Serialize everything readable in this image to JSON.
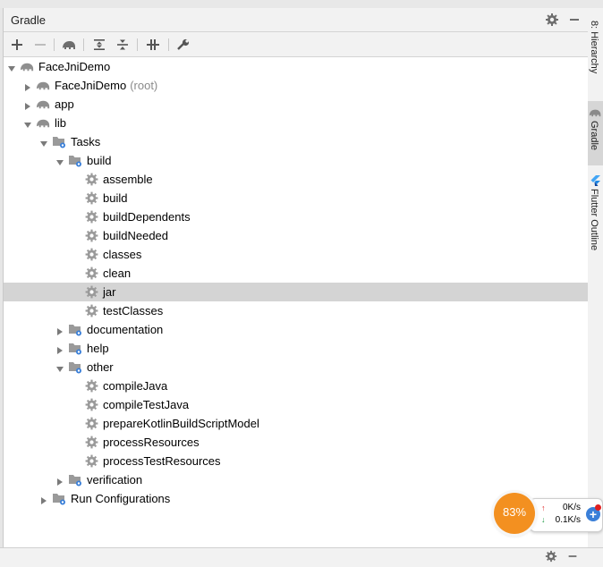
{
  "window": {
    "title": "Gradle"
  },
  "sidebar": {
    "tabs": [
      {
        "label": "8: Hierarchy",
        "active": false
      },
      {
        "label": "Gradle",
        "active": true
      },
      {
        "label": "Flutter Outline",
        "active": false
      }
    ]
  },
  "toolbar": {
    "icons": [
      "add-icon",
      "remove-icon",
      "elephant-icon",
      "expand-all-icon",
      "collapse-all-icon",
      "toggle-offline-icon",
      "wrench-icon"
    ]
  },
  "tree": [
    {
      "label": "FaceJniDemo",
      "suffix": "",
      "depth": 0,
      "arrow": "down",
      "icon": "elephant"
    },
    {
      "label": "FaceJniDemo",
      "suffix": "(root)",
      "depth": 1,
      "arrow": "right",
      "icon": "elephant"
    },
    {
      "label": "app",
      "suffix": "",
      "depth": 1,
      "arrow": "right",
      "icon": "elephant"
    },
    {
      "label": "lib",
      "suffix": "",
      "depth": 1,
      "arrow": "down",
      "icon": "elephant"
    },
    {
      "label": "Tasks",
      "suffix": "",
      "depth": 2,
      "arrow": "down",
      "icon": "folder"
    },
    {
      "label": "build",
      "suffix": "",
      "depth": 3,
      "arrow": "down",
      "icon": "folder"
    },
    {
      "label": "assemble",
      "suffix": "",
      "depth": 4,
      "arrow": "",
      "icon": "gear"
    },
    {
      "label": "build",
      "suffix": "",
      "depth": 4,
      "arrow": "",
      "icon": "gear"
    },
    {
      "label": "buildDependents",
      "suffix": "",
      "depth": 4,
      "arrow": "",
      "icon": "gear"
    },
    {
      "label": "buildNeeded",
      "suffix": "",
      "depth": 4,
      "arrow": "",
      "icon": "gear"
    },
    {
      "label": "classes",
      "suffix": "",
      "depth": 4,
      "arrow": "",
      "icon": "gear"
    },
    {
      "label": "clean",
      "suffix": "",
      "depth": 4,
      "arrow": "",
      "icon": "gear"
    },
    {
      "label": "jar",
      "suffix": "",
      "depth": 4,
      "arrow": "",
      "icon": "gear",
      "selected": true
    },
    {
      "label": "testClasses",
      "suffix": "",
      "depth": 4,
      "arrow": "",
      "icon": "gear"
    },
    {
      "label": "documentation",
      "suffix": "",
      "depth": 3,
      "arrow": "right",
      "icon": "folder"
    },
    {
      "label": "help",
      "suffix": "",
      "depth": 3,
      "arrow": "right",
      "icon": "folder"
    },
    {
      "label": "other",
      "suffix": "",
      "depth": 3,
      "arrow": "down",
      "icon": "folder"
    },
    {
      "label": "compileJava",
      "suffix": "",
      "depth": 4,
      "arrow": "",
      "icon": "gear"
    },
    {
      "label": "compileTestJava",
      "suffix": "",
      "depth": 4,
      "arrow": "",
      "icon": "gear"
    },
    {
      "label": "prepareKotlinBuildScriptModel",
      "suffix": "",
      "depth": 4,
      "arrow": "",
      "icon": "gear"
    },
    {
      "label": "processResources",
      "suffix": "",
      "depth": 4,
      "arrow": "",
      "icon": "gear"
    },
    {
      "label": "processTestResources",
      "suffix": "",
      "depth": 4,
      "arrow": "",
      "icon": "gear"
    },
    {
      "label": "verification",
      "suffix": "",
      "depth": 3,
      "arrow": "right",
      "icon": "folder"
    },
    {
      "label": "Run Configurations",
      "suffix": "",
      "depth": 2,
      "arrow": "right",
      "icon": "folder"
    }
  ],
  "net_widget": {
    "cpu": "83%",
    "up": "0K/s",
    "down": "0.1K/s"
  },
  "colors": {
    "accent": "#f39020",
    "selection": "#d4d4d4",
    "plus": "#3a7fd8"
  }
}
